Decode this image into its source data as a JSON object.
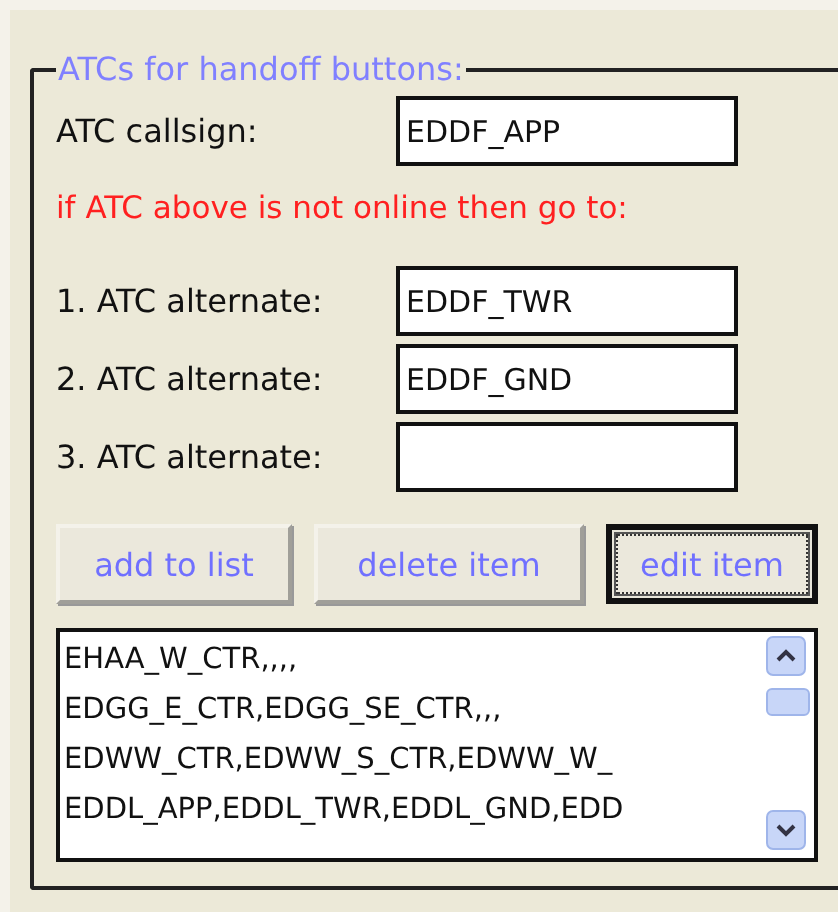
{
  "group": {
    "title": "ATCs for handoff buttons:"
  },
  "callsign": {
    "label": "ATC callsign:",
    "value": "EDDF_APP"
  },
  "warning": "if ATC above is not online then go to:",
  "alternates": [
    {
      "label": "1. ATC alternate:",
      "value": "EDDF_TWR"
    },
    {
      "label": "2. ATC alternate:",
      "value": "EDDF_GND"
    },
    {
      "label": "3. ATC alternate:"
    }
  ],
  "buttons": [
    {
      "label": "add to list",
      "focused": false
    },
    {
      "label": "delete item",
      "focused": false
    },
    {
      "label": "edit item",
      "focused": true
    }
  ],
  "list": {
    "items": [
      "EHAA_W_CTR,,,,",
      "EDGG_E_CTR,EDGG_SE_CTR,,,",
      "EDWW_CTR,EDWW_S_CTR,EDWW_W_",
      "EDDL_APP,EDDL_TWR,EDDL_GND,EDD"
    ]
  }
}
